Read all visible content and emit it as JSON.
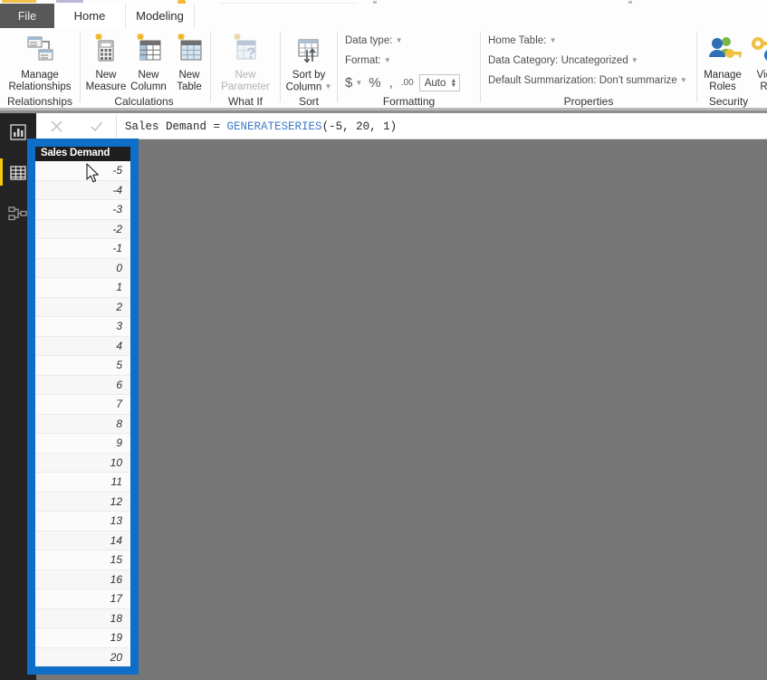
{
  "window": {
    "app": "Power BI Desktop"
  },
  "tabs": [
    {
      "label": "File",
      "name": "tab-file",
      "active": false
    },
    {
      "label": "Home",
      "name": "tab-home",
      "active": false
    },
    {
      "label": "Modeling",
      "name": "tab-modeling",
      "active": true
    }
  ],
  "ribbon": {
    "groups": [
      {
        "label": "Relationships",
        "buttons": [
          {
            "label_line1": "Manage",
            "label_line2": "Relationships",
            "icon": "manage-relationships-icon",
            "disabled": false
          }
        ]
      },
      {
        "label": "Calculations",
        "buttons": [
          {
            "label_line1": "New",
            "label_line2": "Measure",
            "icon": "new-measure-icon",
            "disabled": false
          },
          {
            "label_line1": "New",
            "label_line2": "Column",
            "icon": "new-column-icon",
            "disabled": false
          },
          {
            "label_line1": "New",
            "label_line2": "Table",
            "icon": "new-table-icon",
            "disabled": false
          }
        ]
      },
      {
        "label": "What If",
        "buttons": [
          {
            "label_line1": "New",
            "label_line2": "Parameter",
            "icon": "new-parameter-icon",
            "disabled": true
          }
        ]
      },
      {
        "label": "Sort",
        "buttons": [
          {
            "label_line1": "Sort by",
            "label_line2": "Column",
            "icon": "sort-by-column-icon",
            "disabled": false
          }
        ]
      },
      {
        "label": "Formatting",
        "fields": [
          {
            "label": "Data type:",
            "value": "",
            "name": "data-type-dropdown"
          },
          {
            "label": "Format:",
            "value": "",
            "name": "format-dropdown"
          }
        ],
        "format_toolbar": {
          "currency": "$",
          "percent": "%",
          "thousands": ",",
          "decimal": ".00",
          "decimal_places_value": "Auto"
        }
      },
      {
        "label": "Properties",
        "fields": [
          {
            "label": "Home Table:",
            "value": "",
            "name": "home-table-dropdown"
          },
          {
            "label": "Data Category:",
            "value": "Uncategorized",
            "name": "data-category-dropdown"
          },
          {
            "label": "Default Summarization:",
            "value": "Don't summarize",
            "name": "default-summarization-dropdown"
          }
        ]
      },
      {
        "label": "Security",
        "buttons": [
          {
            "label_line1": "Manage",
            "label_line2": "Roles",
            "icon": "manage-roles-icon",
            "disabled": false
          },
          {
            "label_line1": "View",
            "label_line2": "Rol",
            "icon": "view-as-roles-icon",
            "disabled": false
          }
        ]
      }
    ]
  },
  "left_rail": {
    "items": [
      {
        "name": "report-view-icon",
        "label": "Report",
        "active": false
      },
      {
        "name": "data-view-icon",
        "label": "Data",
        "active": true
      },
      {
        "name": "model-view-icon",
        "label": "Model",
        "active": false
      }
    ]
  },
  "formula_bar": {
    "cancel_label": "✕",
    "accept_label": "✓",
    "text_prefix": "Sales Demand = ",
    "function_name": "GENERATESERIES",
    "text_suffix": "(-5, 20, 1)",
    "full_text": "Sales Demand = GENERATESERIES(-5, 20, 1)"
  },
  "table": {
    "column_header": "Sales Demand",
    "values": [
      "-5",
      "-4",
      "-3",
      "-2",
      "-1",
      "0",
      "1",
      "2",
      "3",
      "4",
      "5",
      "6",
      "7",
      "8",
      "9",
      "10",
      "11",
      "12",
      "13",
      "14",
      "15",
      "16",
      "17",
      "18",
      "19",
      "20"
    ]
  },
  "highlight": {
    "color": "#0f6ec8",
    "target": "sales-demand-column"
  },
  "colors": {
    "canvas_background": "#767676",
    "ribbon_background": "#fdfdfd",
    "file_tab": "#585858",
    "table_header": "#1e1e1e",
    "accent_yellow": "#f2c811",
    "highlight_blue": "#0f6ec8"
  }
}
